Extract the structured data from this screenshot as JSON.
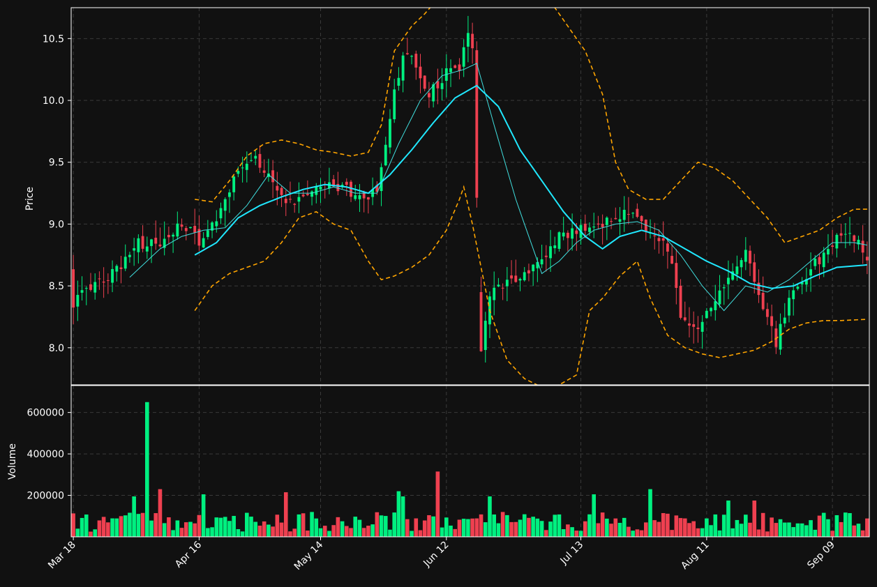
{
  "chart_data": [
    {
      "type": "candlestick",
      "panel": "price",
      "ylabel": "Price",
      "ylim": [
        7.7,
        10.75
      ],
      "yticks": [
        "8.0",
        "8.5",
        "9.0",
        "9.5",
        "10.0",
        "10.5"
      ],
      "ytick_values": [
        8.0,
        8.5,
        9.0,
        9.5,
        10.0,
        10.5
      ],
      "xticks": [
        "Mar 18",
        "Apr 16",
        "May 14",
        "Jun 12",
        "Jul 13",
        "Aug 11",
        "Sep 09"
      ],
      "xtick_index": [
        0,
        29,
        57,
        86,
        117,
        146,
        175
      ],
      "n_bars": 184,
      "colors": {
        "up": "#00f080",
        "down": "#ef4050",
        "ma_short": "#40e0e0",
        "ma_long": "#20e8ff",
        "band": "#ffa500",
        "grid": "#3a3a3a",
        "background": "#111111"
      },
      "close_anchors": [
        [
          0,
          8.37
        ],
        [
          5,
          8.5
        ],
        [
          10,
          8.62
        ],
        [
          15,
          8.85
        ],
        [
          20,
          8.82
        ],
        [
          25,
          9.02
        ],
        [
          29,
          8.85
        ],
        [
          33,
          9.05
        ],
        [
          37,
          9.35
        ],
        [
          41,
          9.55
        ],
        [
          45,
          9.38
        ],
        [
          49,
          9.15
        ],
        [
          53,
          9.25
        ],
        [
          57,
          9.3
        ],
        [
          60,
          9.32
        ],
        [
          63,
          9.28
        ],
        [
          66,
          9.2
        ],
        [
          70,
          9.28
        ],
        [
          72,
          9.6
        ],
        [
          74,
          10.05
        ],
        [
          76,
          10.4
        ],
        [
          79,
          10.3
        ],
        [
          82,
          10.05
        ],
        [
          86,
          10.22
        ],
        [
          89,
          10.25
        ],
        [
          91,
          10.55
        ],
        [
          92,
          10.45
        ],
        [
          94,
          8.0
        ],
        [
          96,
          8.45
        ],
        [
          100,
          8.55
        ],
        [
          104,
          8.6
        ],
        [
          108,
          8.7
        ],
        [
          112,
          8.9
        ],
        [
          116,
          8.95
        ],
        [
          120,
          8.95
        ],
        [
          124,
          9.05
        ],
        [
          128,
          9.1
        ],
        [
          131,
          8.98
        ],
        [
          135,
          8.9
        ],
        [
          138,
          8.7
        ],
        [
          140,
          8.25
        ],
        [
          144,
          8.15
        ],
        [
          148,
          8.4
        ],
        [
          152,
          8.6
        ],
        [
          155,
          8.75
        ],
        [
          158,
          8.45
        ],
        [
          160,
          8.25
        ],
        [
          162,
          8.05
        ],
        [
          165,
          8.4
        ],
        [
          169,
          8.6
        ],
        [
          173,
          8.75
        ],
        [
          176,
          8.9
        ],
        [
          180,
          8.9
        ],
        [
          183,
          8.72
        ]
      ],
      "short_ma_anchors": [
        [
          13,
          8.57
        ],
        [
          20,
          8.8
        ],
        [
          25,
          8.9
        ],
        [
          30,
          8.95
        ],
        [
          35,
          8.97
        ],
        [
          40,
          9.15
        ],
        [
          45,
          9.4
        ],
        [
          50,
          9.25
        ],
        [
          55,
          9.25
        ],
        [
          60,
          9.3
        ],
        [
          65,
          9.25
        ],
        [
          70,
          9.25
        ],
        [
          75,
          9.65
        ],
        [
          80,
          10.0
        ],
        [
          85,
          10.2
        ],
        [
          90,
          10.25
        ],
        [
          93,
          10.3
        ],
        [
          97,
          9.8
        ],
        [
          102,
          9.2
        ],
        [
          108,
          8.6
        ],
        [
          112,
          8.7
        ],
        [
          116,
          8.85
        ],
        [
          120,
          8.95
        ],
        [
          125,
          9.0
        ],
        [
          130,
          9.02
        ],
        [
          135,
          8.95
        ],
        [
          140,
          8.75
        ],
        [
          145,
          8.5
        ],
        [
          150,
          8.3
        ],
        [
          155,
          8.5
        ],
        [
          160,
          8.45
        ],
        [
          165,
          8.55
        ],
        [
          170,
          8.7
        ],
        [
          175,
          8.85
        ],
        [
          180,
          8.85
        ],
        [
          183,
          8.83
        ]
      ],
      "long_ma_anchors": [
        [
          28,
          8.75
        ],
        [
          33,
          8.85
        ],
        [
          38,
          9.05
        ],
        [
          43,
          9.15
        ],
        [
          48,
          9.22
        ],
        [
          53,
          9.28
        ],
        [
          58,
          9.32
        ],
        [
          63,
          9.3
        ],
        [
          68,
          9.25
        ],
        [
          73,
          9.4
        ],
        [
          78,
          9.6
        ],
        [
          83,
          9.82
        ],
        [
          88,
          10.02
        ],
        [
          93,
          10.12
        ],
        [
          98,
          9.95
        ],
        [
          103,
          9.6
        ],
        [
          108,
          9.35
        ],
        [
          113,
          9.1
        ],
        [
          118,
          8.9
        ],
        [
          122,
          8.8
        ],
        [
          126,
          8.9
        ],
        [
          131,
          8.95
        ],
        [
          136,
          8.9
        ],
        [
          141,
          8.8
        ],
        [
          146,
          8.7
        ],
        [
          151,
          8.62
        ],
        [
          156,
          8.52
        ],
        [
          161,
          8.48
        ],
        [
          166,
          8.5
        ],
        [
          171,
          8.58
        ],
        [
          176,
          8.65
        ],
        [
          183,
          8.67
        ]
      ],
      "upper_band_anchors": [
        [
          28,
          9.2
        ],
        [
          32,
          9.18
        ],
        [
          36,
          9.35
        ],
        [
          40,
          9.55
        ],
        [
          44,
          9.65
        ],
        [
          48,
          9.68
        ],
        [
          52,
          9.65
        ],
        [
          56,
          9.6
        ],
        [
          60,
          9.58
        ],
        [
          64,
          9.55
        ],
        [
          68,
          9.58
        ],
        [
          71,
          9.8
        ],
        [
          74,
          10.4
        ],
        [
          78,
          10.6
        ],
        [
          81,
          10.7
        ],
        [
          84,
          10.82
        ],
        [
          88,
          10.9
        ],
        [
          92,
          10.95
        ],
        [
          96,
          10.9
        ],
        [
          100,
          10.88
        ],
        [
          106,
          10.85
        ],
        [
          110,
          10.8
        ],
        [
          114,
          10.6
        ],
        [
          118,
          10.4
        ],
        [
          122,
          10.05
        ],
        [
          125,
          9.5
        ],
        [
          128,
          9.28
        ],
        [
          132,
          9.2
        ],
        [
          136,
          9.2
        ],
        [
          140,
          9.35
        ],
        [
          144,
          9.5
        ],
        [
          148,
          9.45
        ],
        [
          152,
          9.35
        ],
        [
          156,
          9.2
        ],
        [
          160,
          9.05
        ],
        [
          164,
          8.85
        ],
        [
          168,
          8.9
        ],
        [
          172,
          8.95
        ],
        [
          176,
          9.05
        ],
        [
          180,
          9.12
        ],
        [
          183,
          9.12
        ]
      ],
      "lower_band_anchors": [
        [
          28,
          8.3
        ],
        [
          32,
          8.5
        ],
        [
          36,
          8.6
        ],
        [
          40,
          8.65
        ],
        [
          44,
          8.7
        ],
        [
          48,
          8.85
        ],
        [
          52,
          9.05
        ],
        [
          56,
          9.1
        ],
        [
          60,
          9.0
        ],
        [
          64,
          8.95
        ],
        [
          68,
          8.7
        ],
        [
          71,
          8.55
        ],
        [
          74,
          8.58
        ],
        [
          78,
          8.65
        ],
        [
          82,
          8.75
        ],
        [
          86,
          8.95
        ],
        [
          89,
          9.2
        ],
        [
          90,
          9.3
        ],
        [
          92,
          9.0
        ],
        [
          96,
          8.3
        ],
        [
          100,
          7.9
        ],
        [
          104,
          7.75
        ],
        [
          108,
          7.68
        ],
        [
          112,
          7.7
        ],
        [
          116,
          7.78
        ],
        [
          119,
          8.3
        ],
        [
          122,
          8.4
        ],
        [
          126,
          8.58
        ],
        [
          130,
          8.7
        ],
        [
          133,
          8.4
        ],
        [
          137,
          8.1
        ],
        [
          141,
          8.0
        ],
        [
          145,
          7.95
        ],
        [
          149,
          7.92
        ],
        [
          153,
          7.95
        ],
        [
          157,
          7.98
        ],
        [
          161,
          8.05
        ],
        [
          165,
          8.15
        ],
        [
          169,
          8.2
        ],
        [
          173,
          8.22
        ],
        [
          177,
          8.22
        ],
        [
          183,
          8.23
        ]
      ],
      "overlay_start_index": [
        13,
        28,
        28
      ]
    },
    {
      "type": "bar",
      "panel": "volume",
      "ylabel": "Volume",
      "ylim": [
        0,
        730000
      ],
      "yticks": [
        "200000",
        "400000",
        "600000"
      ],
      "ytick_values": [
        200000,
        400000,
        600000
      ],
      "spikes": [
        [
          17,
          650000
        ],
        [
          14,
          195000
        ],
        [
          20,
          230000
        ],
        [
          30,
          205000
        ],
        [
          49,
          215000
        ],
        [
          75,
          220000
        ],
        [
          76,
          195000
        ],
        [
          84,
          315000
        ],
        [
          96,
          195000
        ],
        [
          120,
          205000
        ],
        [
          133,
          230000
        ],
        [
          151,
          175000
        ],
        [
          157,
          175000
        ]
      ]
    }
  ]
}
